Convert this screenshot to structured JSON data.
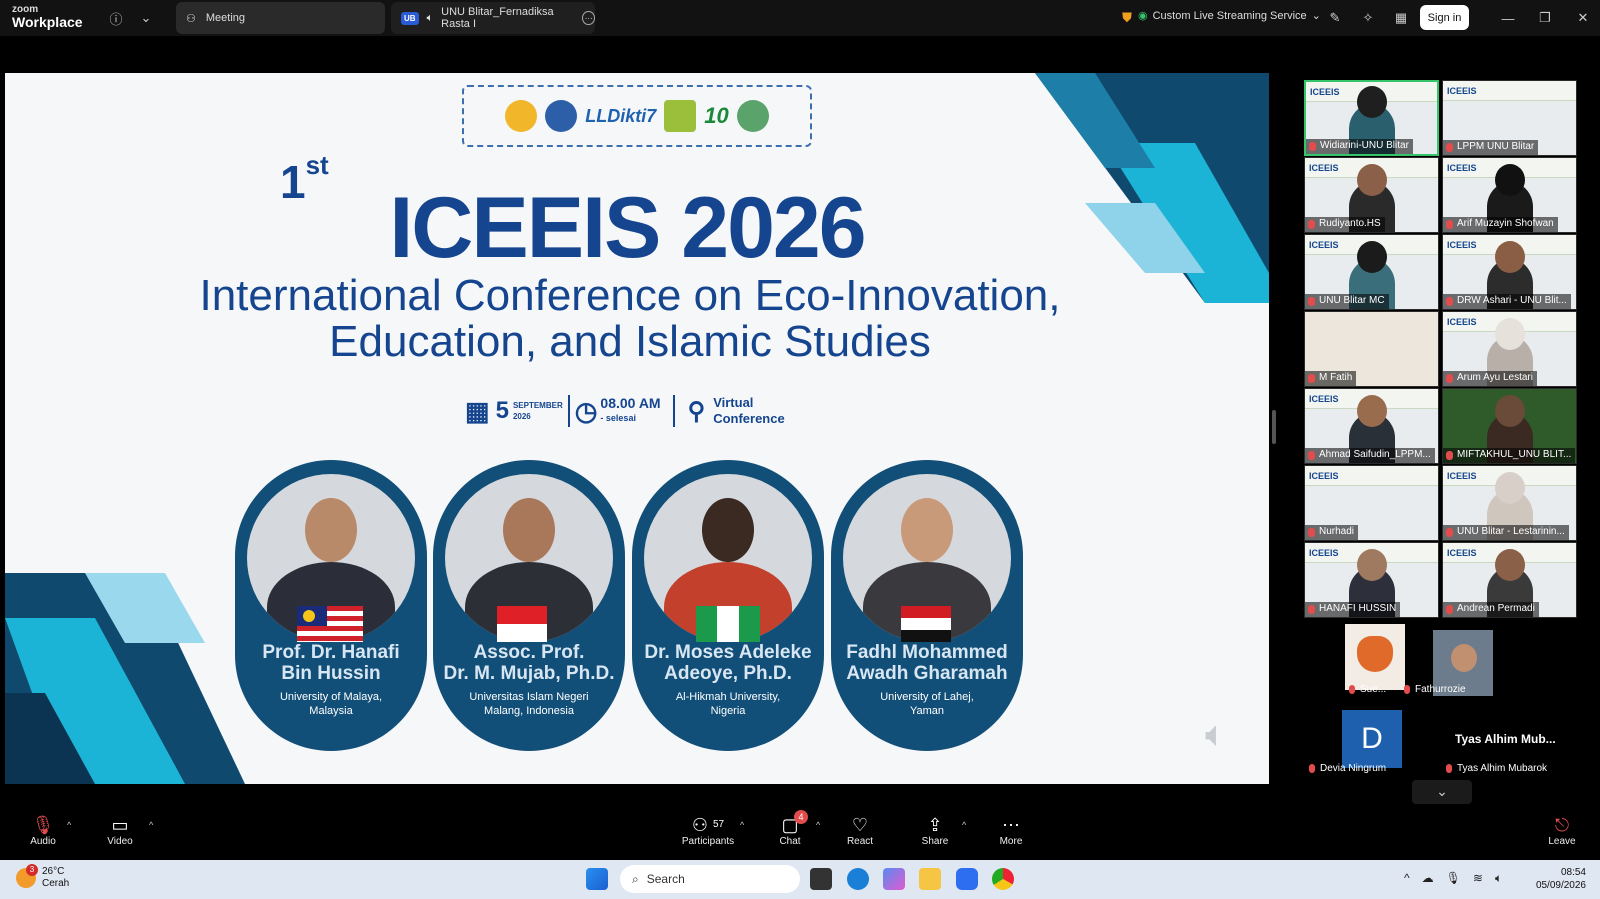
{
  "app": {
    "logo_top": "zoom",
    "logo_bottom": "Workplace"
  },
  "tabs": [
    {
      "label": "Meeting"
    },
    {
      "badge": "UB",
      "label": "UNU Blitar_Fernadiksa Rasta I"
    }
  ],
  "topbar": {
    "streaming_label": "Custom Live Streaming Service",
    "signin_label": "Sign in"
  },
  "slide": {
    "ordinal_number": "1",
    "ordinal_suffix": "st",
    "title": "ICEEIS 2026",
    "subtitle_line1": "International Conference on Eco-Innovation,",
    "subtitle_line2": "Education, and Islamic Studies",
    "date_day": "5",
    "date_month": "SEPTEMBER",
    "date_year": "2026",
    "time": "08.00 AM",
    "time_sub": "- selesai",
    "venue_line1": "Virtual",
    "venue_line2": "Conference",
    "sponsor_text": "LLDikti7",
    "speakers": [
      {
        "name_line1": "Prof. Dr. Hanafi",
        "name_line2": "Bin Hussin",
        "aff_line1": "University of Malaya,",
        "aff_line2": "Malaysia",
        "flag": "malaysia"
      },
      {
        "name_line1": "Assoc. Prof.",
        "name_line2": "Dr. M. Mujab, Ph.D.",
        "aff_line1": "Universitas Islam Negeri",
        "aff_line2": "Malang, Indonesia",
        "flag": "indonesia"
      },
      {
        "name_line1": "Dr. Moses Adeleke",
        "name_line2": "Adeoye, Ph.D.",
        "aff_line1": "Al-Hikmah University,",
        "aff_line2": "Nigeria",
        "flag": "nigeria"
      },
      {
        "name_line1": "Fadhl Mohammed",
        "name_line2": "Awadh Gharamah",
        "aff_line1": "University of Lahej,",
        "aff_line2": "Yaman",
        "flag": "yemen"
      }
    ]
  },
  "participants": [
    {
      "name": "Widiarini-UNU Blitar",
      "active": true
    },
    {
      "name": "LPPM UNU Blitar"
    },
    {
      "name": "Rudiyanto.HS"
    },
    {
      "name": "Arif Muzayin Shofwan"
    },
    {
      "name": "UNU Blitar MC"
    },
    {
      "name": "DRW Ashari - UNU Blit..."
    },
    {
      "name": "M Fatih"
    },
    {
      "name": "Arum Ayu Lestari"
    },
    {
      "name": "Ahmad Saifudin_LPPM..."
    },
    {
      "name": "MIFTAKHUL_UNU BLIT..."
    },
    {
      "name": "Nurhadi"
    },
    {
      "name": "UNU Blitar - Lestarinin..."
    },
    {
      "name": "HANAFI HUSSIN"
    },
    {
      "name": "Andrean Permadi"
    }
  ],
  "small_participants": [
    {
      "name": "Sue..."
    },
    {
      "name": "Fathurrozie"
    }
  ],
  "avatar_participants": [
    {
      "initial": "D",
      "name": "Devia Ningrum"
    },
    {
      "display": "Tyas Alhim Mub...",
      "name": "Tyas Alhim Mubarok"
    }
  ],
  "toolbar": {
    "audio": "Audio",
    "video": "Video",
    "participants": "Participants",
    "participants_count": "57",
    "chat": "Chat",
    "chat_badge": "4",
    "react": "React",
    "share": "Share",
    "more": "More",
    "leave": "Leave"
  },
  "taskbar": {
    "weather_badge": "3",
    "temp": "26°C",
    "condition": "Cerah",
    "search_placeholder": "Search",
    "time": "08:54",
    "date": "05/09/2026"
  }
}
